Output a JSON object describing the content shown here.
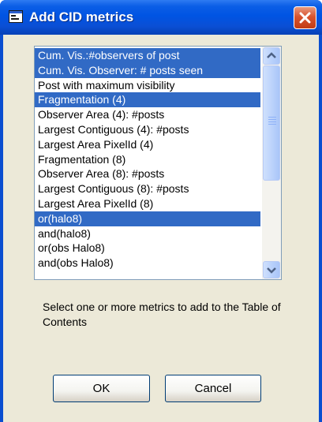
{
  "window": {
    "title": "Add CID metrics",
    "accent": "#0054e3",
    "close_color": "#d9542f"
  },
  "metrics_list": {
    "selection_color": "#316ac5",
    "items": [
      {
        "label": "Cum. Vis.:#observers of post",
        "selected": true
      },
      {
        "label": "Cum. Vis. Observer: # posts seen",
        "selected": true
      },
      {
        "label": "Post with maximum visibility",
        "selected": false
      },
      {
        "label": "Fragmentation (4)",
        "selected": true
      },
      {
        "label": "Observer Area (4): #posts",
        "selected": false
      },
      {
        "label": "Largest Contiguous (4): #posts",
        "selected": false
      },
      {
        "label": "Largest Area PixelId (4)",
        "selected": false
      },
      {
        "label": "Fragmentation (8)",
        "selected": false
      },
      {
        "label": "Observer Area (8): #posts",
        "selected": false
      },
      {
        "label": "Largest Contiguous (8): #posts",
        "selected": false
      },
      {
        "label": "Largest Area PixelId (8)",
        "selected": false
      },
      {
        "label": "or(halo8)",
        "selected": true
      },
      {
        "label": "and(halo8)",
        "selected": false
      },
      {
        "label": "or(obs Halo8)",
        "selected": false
      },
      {
        "label": "and(obs Halo8)",
        "selected": false
      }
    ]
  },
  "hint": "Select one or more metrics to add to the Table of Contents",
  "buttons": {
    "ok": "OK",
    "cancel": "Cancel"
  }
}
